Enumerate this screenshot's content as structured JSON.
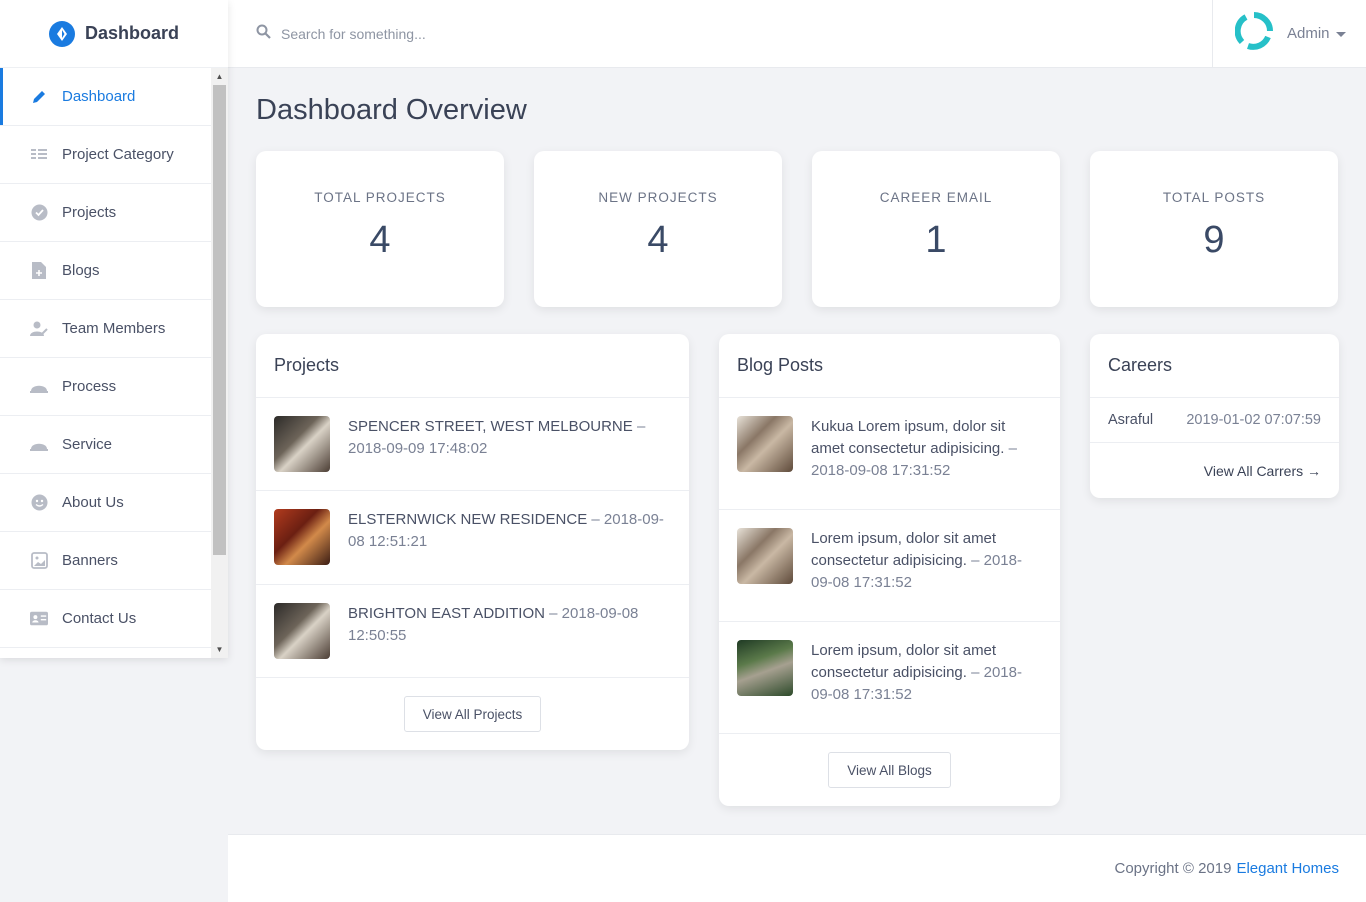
{
  "brand": {
    "title": "Dashboard",
    "accent": "#1a7be0"
  },
  "sidebar": {
    "items": [
      {
        "label": "Dashboard",
        "icon": "pencil-icon",
        "active": true
      },
      {
        "label": "Project Category",
        "icon": "list-icon"
      },
      {
        "label": "Projects",
        "icon": "check-circle-icon"
      },
      {
        "label": "Blogs",
        "icon": "document-plus-icon"
      },
      {
        "label": "Team Members",
        "icon": "user-edit-icon"
      },
      {
        "label": "Process",
        "icon": "cloche-icon"
      },
      {
        "label": "Service",
        "icon": "cloche-icon"
      },
      {
        "label": "About Us",
        "icon": "smiley-icon"
      },
      {
        "label": "Banners",
        "icon": "image-frame-icon"
      },
      {
        "label": "Contact Us",
        "icon": "id-card-icon"
      }
    ]
  },
  "header": {
    "search_placeholder": "Search for something...",
    "user_name": "Admin"
  },
  "main": {
    "title": "Dashboard Overview",
    "stats": [
      {
        "label": "TOTAL PROJECTS",
        "value": "4"
      },
      {
        "label": "NEW PROJECTS",
        "value": "4"
      },
      {
        "label": "CAREER EMAIL",
        "value": "1"
      },
      {
        "label": "TOTAL POSTS",
        "value": "9"
      }
    ],
    "projects": {
      "title": "Projects",
      "items": [
        {
          "name": "SPENCER STREET, WEST MELBOURNE",
          "date": " – 2018-09-09 17:48:02"
        },
        {
          "name": "ELSTERNWICK NEW RESIDENCE",
          "date": " – 2018-09-08 12:51:21"
        },
        {
          "name": "BRIGHTON EAST ADDITION",
          "date": " – 2018-09-08 12:50:55"
        }
      ],
      "button": "View All Projects"
    },
    "blogs": {
      "title": "Blog Posts",
      "items": [
        {
          "name": "Kukua Lorem ipsum, dolor sit amet consectetur adipisicing.",
          "date": " – 2018-09-08 17:31:52"
        },
        {
          "name": "Lorem ipsum, dolor sit amet consectetur adipisicing.",
          "date": " – 2018-09-08 17:31:52"
        },
        {
          "name": "Lorem ipsum, dolor sit amet consectetur adipisicing.",
          "date": " – 2018-09-08 17:31:52"
        }
      ],
      "button": "View All Blogs"
    },
    "careers": {
      "title": "Careers",
      "items": [
        {
          "name": "Asraful",
          "date": "2019-01-02 07:07:59"
        }
      ],
      "link": "View All Carrers →"
    }
  },
  "footer": {
    "copyright": "Copyright © 2019",
    "company": "Elegant Homes"
  }
}
